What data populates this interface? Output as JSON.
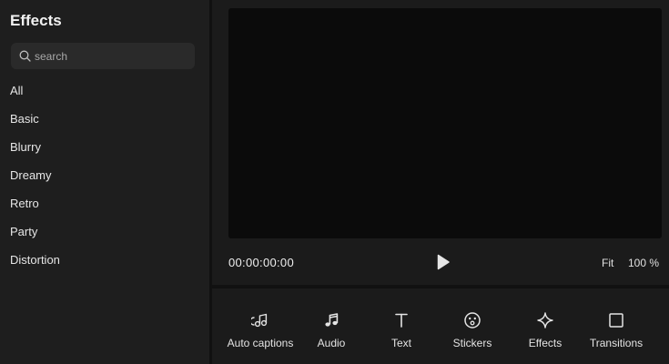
{
  "sidebar": {
    "title": "Effects",
    "search_placeholder": "search",
    "categories": [
      "All",
      "Basic",
      "Blurry",
      "Dreamy",
      "Retro",
      "Party",
      "Distortion"
    ]
  },
  "preview": {
    "timecode": "00:00:00:00",
    "fit_label": "Fit",
    "zoom": "100 %"
  },
  "toolbar": {
    "items": [
      {
        "label": "Auto captions",
        "icon": "auto-captions-icon"
      },
      {
        "label": "Audio",
        "icon": "music-note-icon"
      },
      {
        "label": "Text",
        "icon": "text-t-icon"
      },
      {
        "label": "Stickers",
        "icon": "sticker-face-icon"
      },
      {
        "label": "Effects",
        "icon": "sparkle-icon"
      },
      {
        "label": "Transitions",
        "icon": "square-icon"
      }
    ]
  }
}
